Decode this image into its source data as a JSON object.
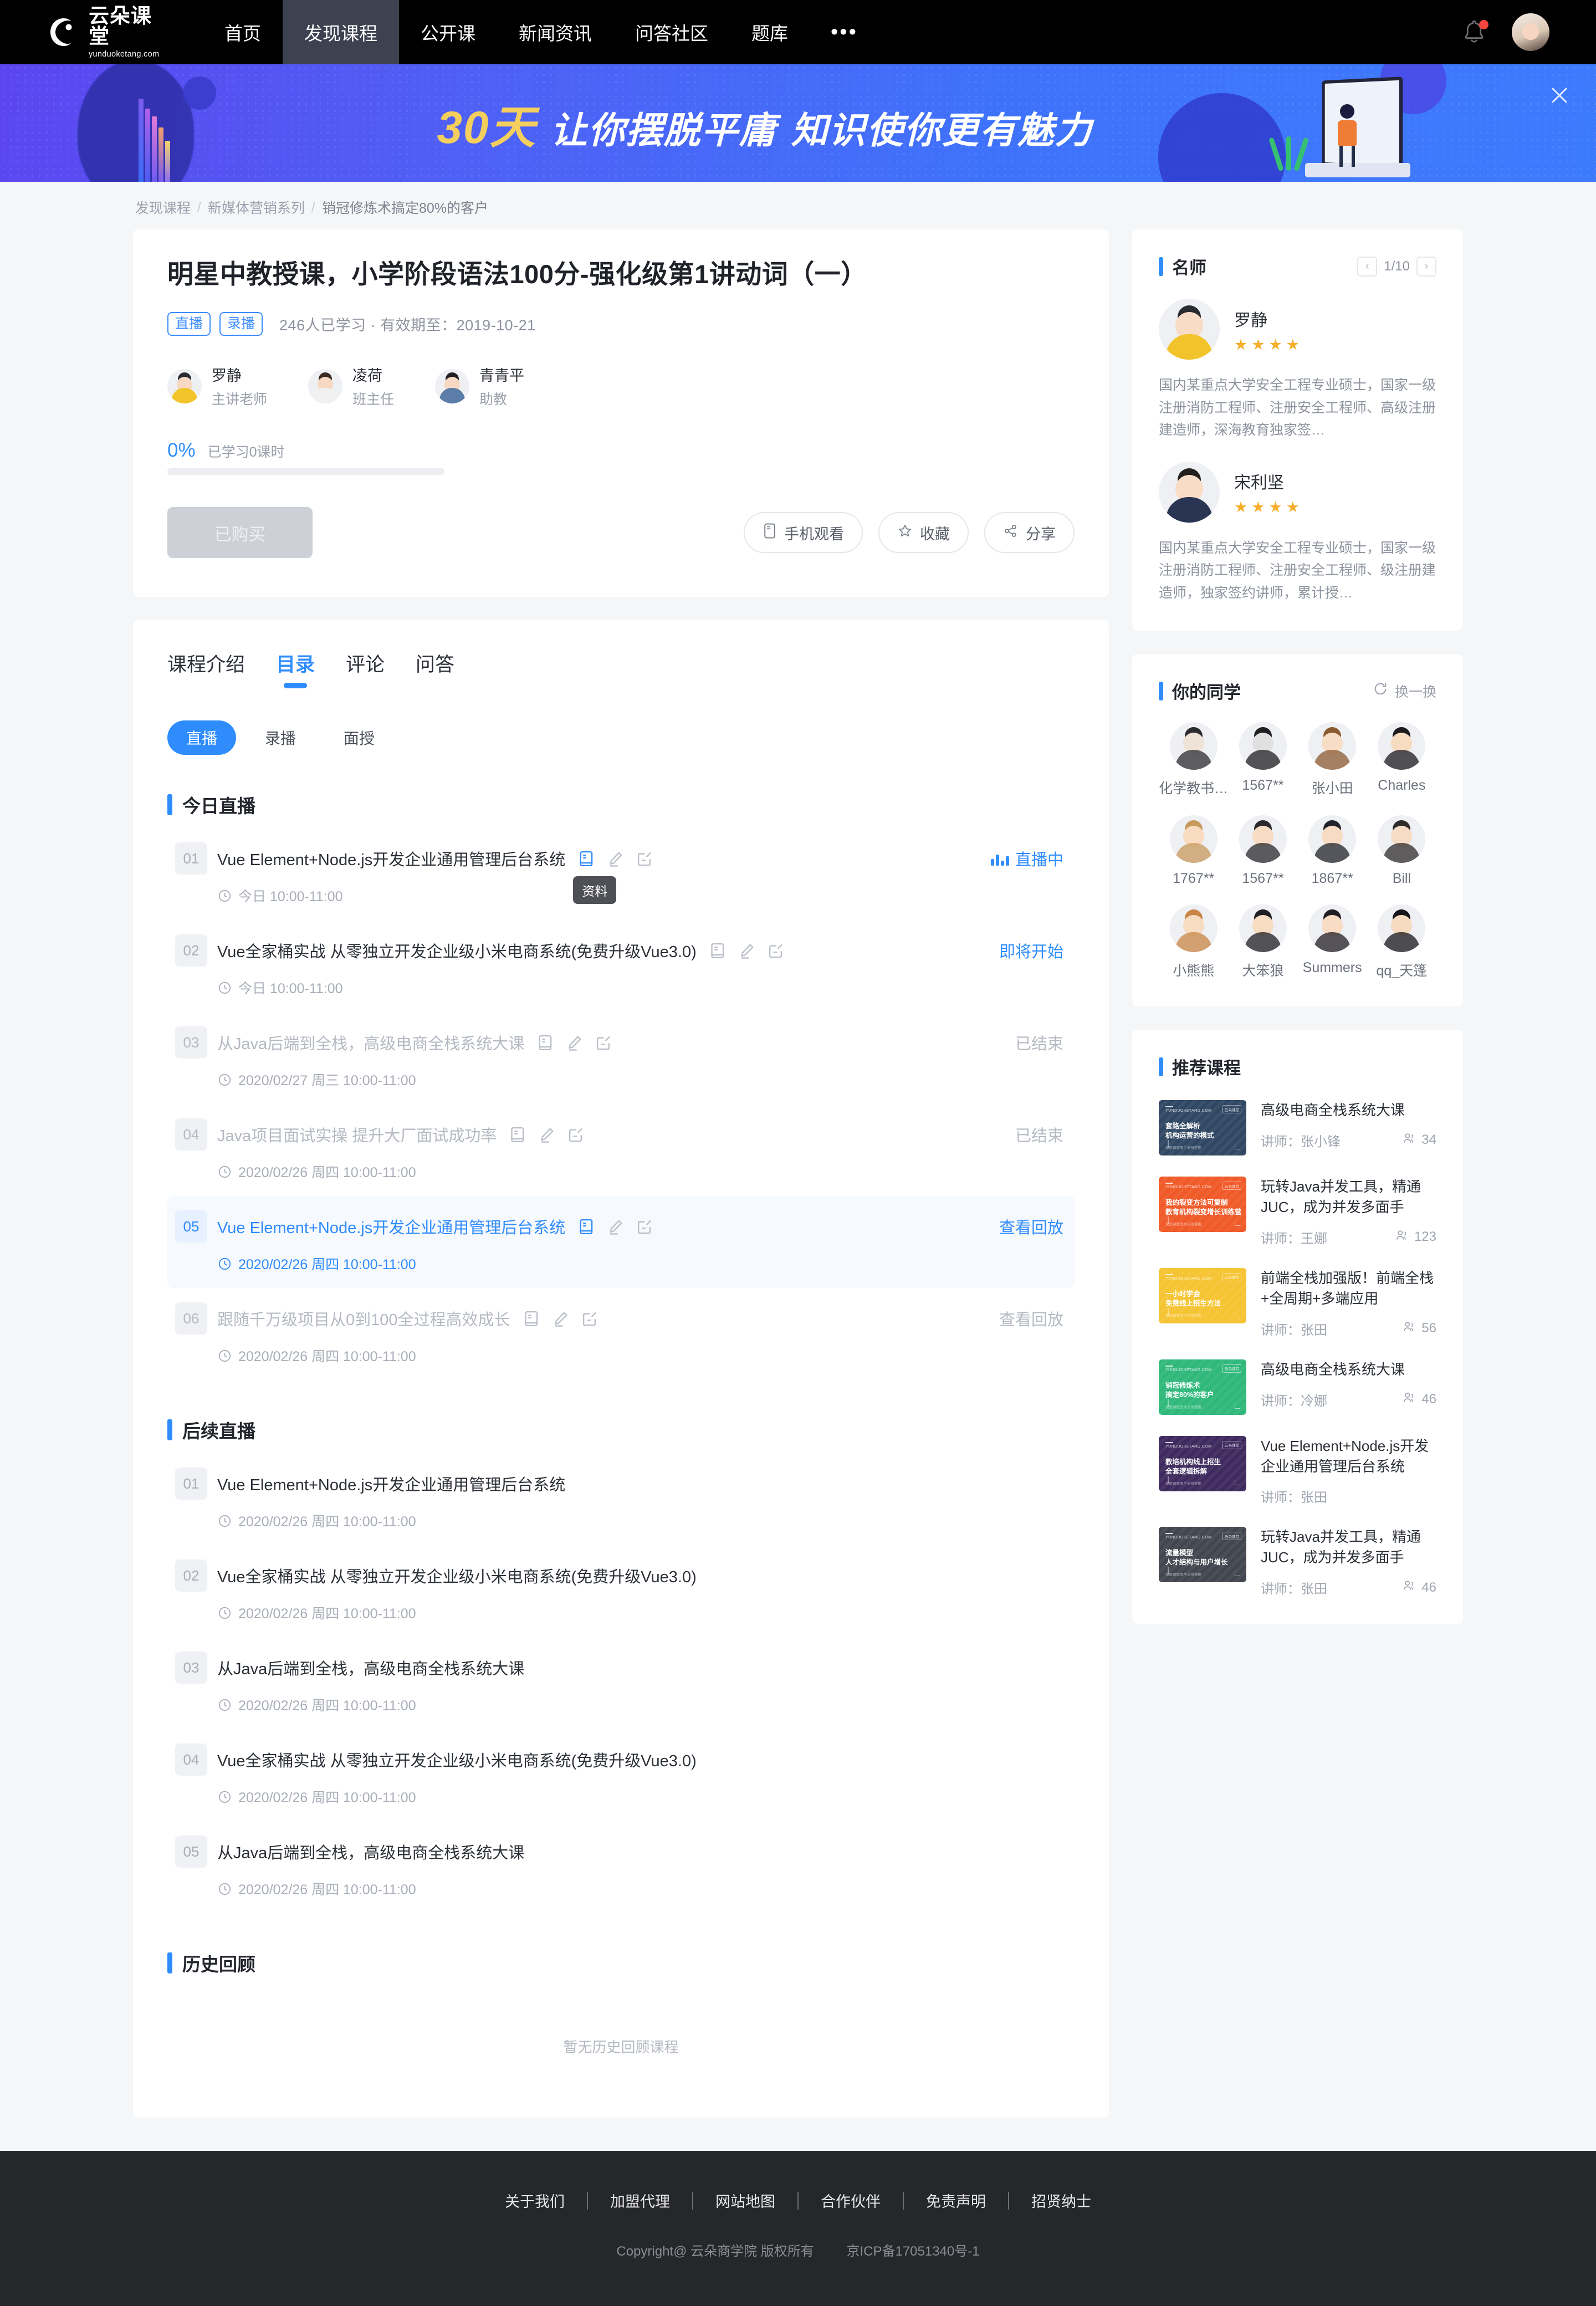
{
  "nav": {
    "logo_cn": "云朵课堂",
    "logo_en": "yunduoketang.com",
    "items": [
      {
        "label": "首页",
        "active": false
      },
      {
        "label": "发现课程",
        "active": true
      },
      {
        "label": "公开课",
        "active": false
      },
      {
        "label": "新闻资讯",
        "active": false
      },
      {
        "label": "问答社区",
        "active": false
      },
      {
        "label": "题库",
        "active": false
      }
    ],
    "more": "•••"
  },
  "banner": {
    "highlight": "30天",
    "text1": "让你摆脱平庸",
    "text2": "知识使你更有魅力"
  },
  "breadcrumb": {
    "items": [
      "发现课程",
      "新媒体营销系列",
      "销冠修炼术搞定80%的客户"
    ],
    "separator": "/"
  },
  "course": {
    "title": "明星中教授课，小学阶段语法100分-强化级第1讲动词（一）",
    "tags": [
      "直播",
      "录播"
    ],
    "meta": "246人已学习 · 有效期至：2019-10-21",
    "teachers": [
      {
        "name": "罗静",
        "role": "主讲老师"
      },
      {
        "name": "凌荷",
        "role": "班主任"
      },
      {
        "name": "青青平",
        "role": "助教"
      }
    ],
    "progress_pct": "0%",
    "progress_value": 0,
    "progress_label": "已学习0课时",
    "buy_button": "已购买",
    "actions": [
      {
        "label": "手机观看",
        "icon": "mobile-icon"
      },
      {
        "label": "收藏",
        "icon": "star-icon"
      },
      {
        "label": "分享",
        "icon": "share-icon"
      }
    ]
  },
  "tabs": [
    {
      "label": "课程介绍",
      "active": false
    },
    {
      "label": "目录",
      "active": true
    },
    {
      "label": "评论",
      "active": false
    },
    {
      "label": "问答",
      "active": false
    }
  ],
  "subtabs": [
    {
      "label": "直播",
      "active": true
    },
    {
      "label": "录播",
      "active": false
    },
    {
      "label": "面授",
      "active": false
    }
  ],
  "tooltip": "资料",
  "sections": {
    "today": {
      "title": "今日直播",
      "lessons": [
        {
          "no": "01",
          "name": "Vue Element+Node.js开发企业通用管理后台系统",
          "time": "今日 10:00-11:00",
          "status": "直播中",
          "state": "live",
          "icons": true
        },
        {
          "no": "02",
          "name": "Vue全家桶实战 从零独立开发企业级小米电商系统(免费升级Vue3.0)",
          "time": "今日 10:00-11:00",
          "status": "即将开始",
          "state": "soon",
          "icons": true
        },
        {
          "no": "03",
          "name": "从Java后端到全栈，高级电商全栈系统大课",
          "time": "2020/02/27 周三 10:00-11:00",
          "status": "已结束",
          "state": "ended",
          "icons": true
        },
        {
          "no": "04",
          "name": "Java项目面试实操 提升大厂面试成功率",
          "time": "2020/02/26 周四 10:00-11:00",
          "status": "已结束",
          "state": "ended",
          "icons": true
        },
        {
          "no": "05",
          "name": "Vue Element+Node.js开发企业通用管理后台系统",
          "time": "2020/02/26 周四 10:00-11:00",
          "status": "查看回放",
          "state": "highlight",
          "icons": true
        },
        {
          "no": "06",
          "name": "跟随千万级项目从0到100全过程高效成长",
          "time": "2020/02/26 周四 10:00-11:00",
          "status": "查看回放",
          "state": "replay-dim",
          "icons": true
        }
      ]
    },
    "upcoming": {
      "title": "后续直播",
      "lessons": [
        {
          "no": "01",
          "name": "Vue Element+Node.js开发企业通用管理后台系统",
          "time": "2020/02/26 周四 10:00-11:00",
          "status": "",
          "state": "plain",
          "icons": false
        },
        {
          "no": "02",
          "name": "Vue全家桶实战 从零独立开发企业级小米电商系统(免费升级Vue3.0)",
          "time": "2020/02/26 周四 10:00-11:00",
          "status": "",
          "state": "plain",
          "icons": false
        },
        {
          "no": "03",
          "name": "从Java后端到全栈，高级电商全栈系统大课",
          "time": "2020/02/26 周四 10:00-11:00",
          "status": "",
          "state": "plain",
          "icons": false
        },
        {
          "no": "04",
          "name": "Vue全家桶实战 从零独立开发企业级小米电商系统(免费升级Vue3.0)",
          "time": "2020/02/26 周四 10:00-11:00",
          "status": "",
          "state": "plain",
          "icons": false
        },
        {
          "no": "05",
          "name": "从Java后端到全栈，高级电商全栈系统大课",
          "time": "2020/02/26 周四 10:00-11:00",
          "status": "",
          "state": "plain",
          "icons": false
        }
      ]
    },
    "history": {
      "title": "历史回顾",
      "empty_text": "暂无历史回顾课程"
    }
  },
  "side": {
    "masters": {
      "title": "名师",
      "page": "1/10",
      "prev": "‹",
      "next": "›",
      "items": [
        {
          "name": "罗静",
          "stars": 4,
          "desc": "国内某重点大学安全工程专业硕士，国家一级注册消防工程师、注册安全工程师、高级注册建造师，深海教育独家签…",
          "gender": "f"
        },
        {
          "name": "宋利坚",
          "stars": 4,
          "desc": "国内某重点大学安全工程专业硕士，国家一级注册消防工程师、注册安全工程师、级注册建造师，独家签约讲师，累计授…",
          "gender": "m"
        }
      ]
    },
    "classmates": {
      "title": "你的同学",
      "refresh_label": "换一换",
      "items": [
        {
          "name": "化学教书…",
          "skin": "#efe2d7",
          "hair": "#2c2b30"
        },
        {
          "name": "1567**",
          "skin": "#e0e0e0",
          "hair": "#1f1f22"
        },
        {
          "name": "张小田",
          "skin": "#f7ddc5",
          "hair": "#8b5a30"
        },
        {
          "name": "Charles",
          "skin": "#f7dcc2",
          "hair": "#1b1a1f"
        },
        {
          "name": "1767**",
          "skin": "#f9dcc0",
          "hair": "#c79a5c"
        },
        {
          "name": "1567**",
          "skin": "#f8dcc4",
          "hair": "#2a2a2e"
        },
        {
          "name": "1867**",
          "skin": "#f7dcc3",
          "hair": "#22222a"
        },
        {
          "name": "Bill",
          "skin": "#f6dcc5",
          "hair": "#2e2b2a"
        },
        {
          "name": "小熊熊",
          "skin": "#f8dcc2",
          "hair": "#c88545"
        },
        {
          "name": "大笨狼",
          "skin": "#f7dcc2",
          "hair": "#1f1e22"
        },
        {
          "name": "Summers",
          "skin": "#f8dcc4",
          "hair": "#221f24"
        },
        {
          "name": "qq_天篷",
          "skin": "#f6dbc1",
          "hair": "#17161a"
        }
      ]
    },
    "recommended": {
      "title": "推荐课程",
      "teacher_prefix": "讲师：",
      "items": [
        {
          "title": "高级电商全栈系统大课",
          "teacher": "张小锋",
          "count": "34",
          "thumb_color": "#2f4763",
          "thumb_line1": "套路全解析",
          "thumb_line2": "机构运营的模式",
          "thumb_logo": "YUNDUOKETANG.COM",
          "thumb_badge": "云朵课堂",
          "thumb_foot": "仅限课程图片分辨使用"
        },
        {
          "title": "玩转Java并发工具，精通JUC，成为并发多面手",
          "teacher": "王娜",
          "count": "123",
          "thumb_color": "#f05a28",
          "thumb_line1": "我的裂变方法可复制",
          "thumb_line2": "教育机构裂变增长训练营",
          "thumb_logo": "YUNDUOKETANG.COM",
          "thumb_badge": "云朵课堂",
          "thumb_foot": "仅限课程图片分辨使用"
        },
        {
          "title": "前端全栈加强版！前端全栈+全周期+多端应用",
          "teacher": "张田",
          "count": "56",
          "thumb_color": "#f6c githubc33",
          "thumb_line1": "一小时学会",
          "thumb_line2": "免费线上招生方法",
          "thumb_logo": "YUNDUOKETANG.COM",
          "thumb_badge": "云朵课堂",
          "thumb_foot": "仅限课程图片分辨使用"
        },
        {
          "title": "高级电商全栈系统大课",
          "teacher": "冷娜",
          "count": "46",
          "thumb_color": "#2fb87a",
          "thumb_line1": "销冠修炼术",
          "thumb_line2": "搞定80%的客户",
          "thumb_logo": "YUNDUOKETANG.COM",
          "thumb_badge": "云朵课堂",
          "thumb_foot": "仅限课程图片分辨使用"
        },
        {
          "title": "Vue Element+Node.js开发企业通用管理后台系统",
          "teacher": "张田",
          "count": "",
          "thumb_color": "#3e2a5e",
          "thumb_line1": "教培机构线上招生",
          "thumb_line2": "全套逻辑拆解",
          "thumb_logo": "YUNDUOKETANG.COM",
          "thumb_badge": "云朵课堂",
          "thumb_foot": "仅限课程图片分辨使用"
        },
        {
          "title": "玩转Java并发工具，精通JUC，成为并发多面手",
          "teacher": "张田",
          "count": "46",
          "thumb_color": "#41464f",
          "thumb_line1": "流量模型",
          "thumb_line2": "人才结构与用户增长",
          "thumb_logo": "YUNDUOKETANG.COM",
          "thumb_badge": "云朵课堂",
          "thumb_foot": "仅限课程图片分辨使用"
        }
      ]
    }
  },
  "footer": {
    "links": [
      "关于我们",
      "加盟代理",
      "网站地图",
      "合作伙伴",
      "免责声明",
      "招贤纳士"
    ],
    "copyright": "Copyright@ 云朵商学院  版权所有",
    "icp": "京ICP备17051340号-1"
  },
  "colors": {
    "accent": "#2f8cfd",
    "nav_bg": "#000000",
    "nav_active": "#3c4250",
    "footer_bg": "#26272b",
    "star": "#f6ae2b"
  }
}
